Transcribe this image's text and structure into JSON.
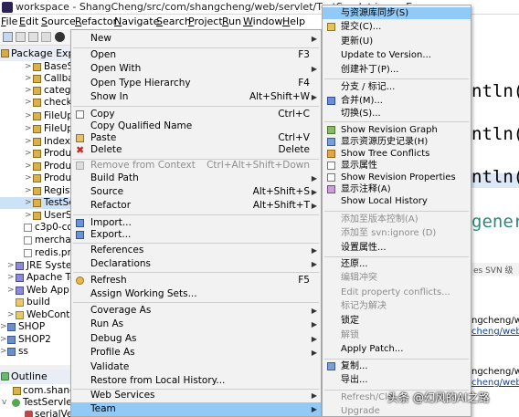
{
  "window": {
    "title": "workspace - ShangCheng/src/com/shangcheng/web/servlet/TestServlet.java - Ec"
  },
  "menubar": [
    "File",
    "Edit",
    "Source",
    "Refactor",
    "Navigate",
    "Search",
    "Project",
    "Run",
    "Window",
    "Help"
  ],
  "package_explorer": {
    "title": "Package Explore",
    "items": [
      "BaseSe",
      "Callbac",
      "catego",
      "checkU",
      "FileUpl",
      "FileUpl",
      "IndexS",
      "Produ",
      "Produ",
      "Produ",
      "Registe",
      "TestSer",
      "UserSe",
      "c3p0-con",
      "merchan",
      "redis.pro",
      "JRE System",
      "Apache Tor",
      "Web App L",
      "build",
      "WebConten",
      "SHOP",
      "SHOP2",
      "ss"
    ]
  },
  "outline": {
    "title": "Outline",
    "items": [
      "com.shangc",
      "TestServlet",
      "serialVers"
    ]
  },
  "editor_fragments": [
    "ntln(",
    "ntln(",
    "ntln(",
    "genera"
  ],
  "console": {
    "tabs": "es  SVN 级",
    "lines": [
      "ngcheng/web/",
      "cheng/web/s",
      "ngcheng/web/",
      "cheng/web/s"
    ]
  },
  "context_menu": {
    "items": [
      {
        "label": "New",
        "shortcut": "",
        "submenu": true
      },
      {
        "label": "Open",
        "shortcut": "F3",
        "submenu": false
      },
      {
        "label": "Open With",
        "shortcut": "",
        "submenu": true
      },
      {
        "label": "Open Type Hierarchy",
        "shortcut": "F4",
        "submenu": false
      },
      {
        "label": "Show In",
        "shortcut": "Alt+Shift+W",
        "submenu": true
      },
      {
        "label": "Copy",
        "shortcut": "Ctrl+C",
        "submenu": false
      },
      {
        "label": "Copy Qualified Name",
        "shortcut": "",
        "submenu": false
      },
      {
        "label": "Paste",
        "shortcut": "Ctrl+V",
        "submenu": false
      },
      {
        "label": "Delete",
        "shortcut": "Delete",
        "submenu": false
      },
      {
        "label": "Remove from Context",
        "shortcut": "Ctrl+Alt+Shift+Down",
        "submenu": false,
        "disabled": true
      },
      {
        "label": "Build Path",
        "shortcut": "",
        "submenu": true
      },
      {
        "label": "Source",
        "shortcut": "Alt+Shift+S",
        "submenu": true
      },
      {
        "label": "Refactor",
        "shortcut": "Alt+Shift+T",
        "submenu": true
      },
      {
        "label": "Import...",
        "shortcut": "",
        "submenu": false
      },
      {
        "label": "Export...",
        "shortcut": "",
        "submenu": false
      },
      {
        "label": "References",
        "shortcut": "",
        "submenu": true
      },
      {
        "label": "Declarations",
        "shortcut": "",
        "submenu": true
      },
      {
        "label": "Refresh",
        "shortcut": "F5",
        "submenu": false
      },
      {
        "label": "Assign Working Sets...",
        "shortcut": "",
        "submenu": false
      },
      {
        "label": "Coverage As",
        "shortcut": "",
        "submenu": true
      },
      {
        "label": "Run As",
        "shortcut": "",
        "submenu": true
      },
      {
        "label": "Debug As",
        "shortcut": "",
        "submenu": true
      },
      {
        "label": "Profile As",
        "shortcut": "",
        "submenu": true
      },
      {
        "label": "Validate",
        "shortcut": "",
        "submenu": false
      },
      {
        "label": "Restore from Local History...",
        "shortcut": "",
        "submenu": false
      },
      {
        "label": "Web Services",
        "shortcut": "",
        "submenu": true
      },
      {
        "label": "Team",
        "shortcut": "",
        "submenu": true,
        "active": true
      }
    ]
  },
  "team_submenu": {
    "items": [
      {
        "label": "与资源库同步(S)",
        "active": true
      },
      {
        "label": "提交(C)..."
      },
      {
        "label": "更新(U)"
      },
      {
        "label": "Update to Version..."
      },
      {
        "label": "创建补丁(P)..."
      },
      {
        "label": "分支 / 标记..."
      },
      {
        "label": "合并(M)..."
      },
      {
        "label": "切换(S)..."
      },
      {
        "label": "Show Revision Graph"
      },
      {
        "label": "显示资源历史记录(H)"
      },
      {
        "label": "Show Tree Conflicts"
      },
      {
        "label": "显示属性"
      },
      {
        "label": "Show Revision Properties"
      },
      {
        "label": "显示注释(A)"
      },
      {
        "label": "Show Local History"
      },
      {
        "label": "添加至版本控制(A)",
        "disabled": true
      },
      {
        "label": "添加至 svn:ignore (D)",
        "disabled": true
      },
      {
        "label": "设置属性..."
      },
      {
        "label": "还原..."
      },
      {
        "label": "编辑冲突",
        "disabled": true
      },
      {
        "label": "Edit property conflicts...",
        "disabled": true
      },
      {
        "label": "标记为解决",
        "disabled": true
      },
      {
        "label": "锁定"
      },
      {
        "label": "解锁",
        "disabled": true
      },
      {
        "label": "Apply Patch..."
      },
      {
        "label": "复制..."
      },
      {
        "label": "导出..."
      },
      {
        "label": "Refresh/Cle",
        "disabled": true
      },
      {
        "label": "Upgrade",
        "disabled": true
      }
    ]
  },
  "watermark": "头条 @幻风的AI之路",
  "colors": {
    "menu_highlight": "#91c9f7",
    "menu_background": "#f2f2f2",
    "disabled_text": "#8d8d8d"
  }
}
